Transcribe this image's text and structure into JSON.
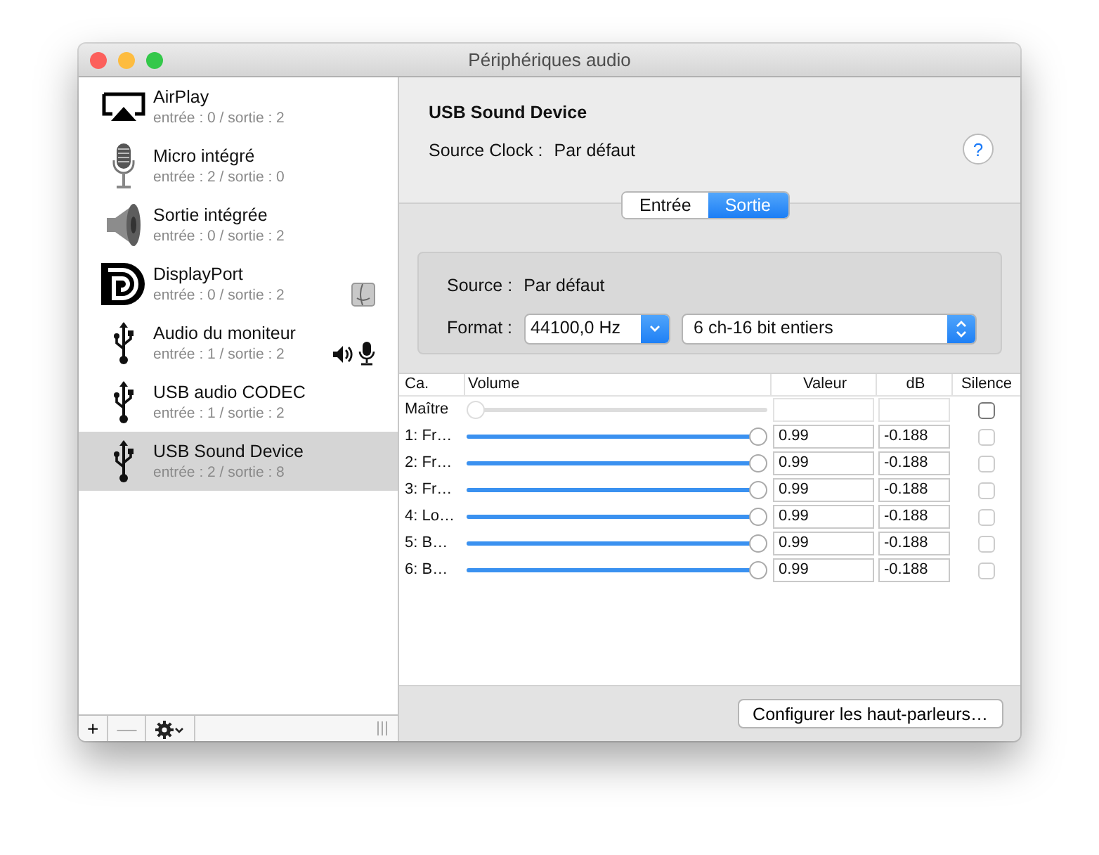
{
  "window": {
    "title": "Périphériques audio"
  },
  "devices": [
    {
      "name": "AirPlay",
      "channels": "entrée : 0 / sortie : 2",
      "kind": "airplay",
      "selected": false,
      "system_output": false,
      "default_output": false,
      "default_input": false
    },
    {
      "name": "Micro intégré",
      "channels": "entrée : 2 / sortie : 0",
      "kind": "microphone",
      "selected": false,
      "system_output": false,
      "default_output": false,
      "default_input": false
    },
    {
      "name": "Sortie intégrée",
      "channels": "entrée : 0 / sortie : 2",
      "kind": "speaker",
      "selected": false,
      "system_output": false,
      "default_output": false,
      "default_input": false
    },
    {
      "name": "DisplayPort",
      "channels": "entrée : 0 / sortie : 2",
      "kind": "displayport",
      "selected": false,
      "system_output": true,
      "default_output": false,
      "default_input": false
    },
    {
      "name": "Audio du moniteur",
      "channels": "entrée : 1 / sortie : 2",
      "kind": "usb",
      "selected": false,
      "system_output": false,
      "default_output": true,
      "default_input": true
    },
    {
      "name": "USB audio CODEC",
      "channels": "entrée : 1 / sortie : 2",
      "kind": "usb",
      "selected": false,
      "system_output": false,
      "default_output": false,
      "default_input": false
    },
    {
      "name": "USB Sound Device",
      "channels": "entrée : 2 / sortie : 8",
      "kind": "usb",
      "selected": true,
      "system_output": false,
      "default_output": false,
      "default_input": false
    }
  ],
  "sidebar_toolbar": {
    "add": "+",
    "remove": "—"
  },
  "detail": {
    "title": "USB Sound Device",
    "clock_label": "Source Clock :",
    "clock_value": "Par défaut",
    "help": "?"
  },
  "tabs": [
    {
      "label": "Entrée",
      "selected": false
    },
    {
      "label": "Sortie",
      "selected": true
    }
  ],
  "format_group": {
    "source_label": "Source :",
    "source_value": "Par défaut",
    "format_label": "Format :",
    "rate": "44100,0 Hz",
    "format": "6 ch-16 bit entiers"
  },
  "table": {
    "columns": [
      "Ca.",
      "Volume",
      "Valeur",
      "dB",
      "Silence"
    ],
    "rows": [
      {
        "kind": "master",
        "channel": "Maître",
        "level": 0,
        "muted": false,
        "disabled": false
      },
      {
        "kind": "channel",
        "channel": "1: Fr…",
        "level": 1,
        "value": "0.99",
        "db": "-0.188",
        "muted": false,
        "disabled": true
      },
      {
        "kind": "channel",
        "channel": "2: Fr…",
        "level": 1,
        "value": "0.99",
        "db": "-0.188",
        "muted": false,
        "disabled": true
      },
      {
        "kind": "channel",
        "channel": "3: Fr…",
        "level": 1,
        "value": "0.99",
        "db": "-0.188",
        "muted": false,
        "disabled": true
      },
      {
        "kind": "channel",
        "channel": "4: Lo…",
        "level": 1,
        "value": "0.99",
        "db": "-0.188",
        "muted": false,
        "disabled": true
      },
      {
        "kind": "channel",
        "channel": "5: B…",
        "level": 1,
        "value": "0.99",
        "db": "-0.188",
        "muted": false,
        "disabled": true
      },
      {
        "kind": "channel",
        "channel": "6: B…",
        "level": 1,
        "value": "0.99",
        "db": "-0.188",
        "muted": false,
        "disabled": true
      }
    ]
  },
  "footer_button": "Configurer les haut-parleurs…"
}
